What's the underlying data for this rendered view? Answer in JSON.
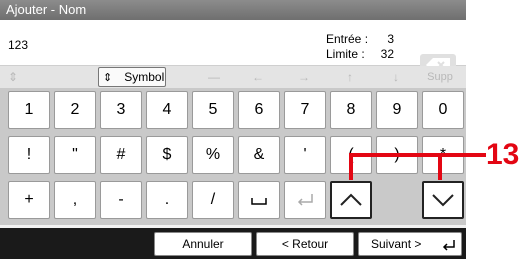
{
  "window": {
    "title": "Ajouter - Nom"
  },
  "input": {
    "value": "123"
  },
  "counters": {
    "entry_label": "Entrée :",
    "entry_value": "3",
    "limit_label": "Limite :",
    "limit_value": "32"
  },
  "toolbar": {
    "symbol_label": "Symbol",
    "delete_label": "Supp"
  },
  "keys": {
    "row1": [
      "1",
      "2",
      "3",
      "4",
      "5",
      "6",
      "7",
      "8",
      "9",
      "0"
    ],
    "row2": [
      "!",
      "\"",
      "#",
      "$",
      "%",
      "&",
      "'",
      "(",
      ")",
      "*"
    ],
    "row3": [
      "+",
      ",",
      "-",
      ".",
      "/"
    ]
  },
  "footer": {
    "cancel_label": "Annuler",
    "back_label": "< Retour",
    "next_label": "Suivant >"
  },
  "callout": {
    "label": "13",
    "color": "#e30613"
  },
  "colors": {
    "titlebar": "#7a7a7a",
    "footer": "#1a1a1a",
    "keyboard_bg": "#c9c9c9"
  }
}
